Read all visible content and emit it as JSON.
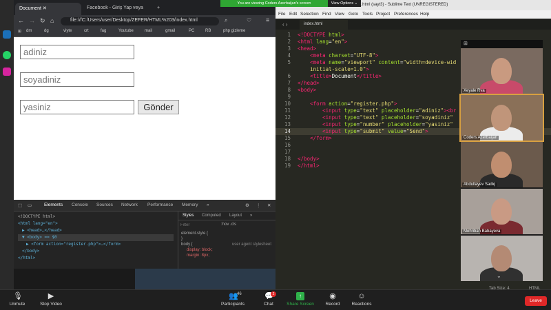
{
  "share_banner": "You are viewing Coders Azerbaijan's screen",
  "view_options": "View Options ⌄",
  "browser": {
    "tabs": [
      {
        "label": "Document"
      },
      {
        "label": "Facebook - Giriş Yap veya"
      }
    ],
    "url": "file:///C:/Users/user/Desktop/ZEFER/HTML%203/index.html",
    "bookmarks": [
      "dm",
      "dg",
      "viyte",
      "crt",
      "fag",
      "Youtube",
      "mail",
      "gmail",
      "PC",
      "RB",
      "php gizleme"
    ],
    "form": {
      "first_placeholder": "adiniz",
      "last_placeholder": "soyadiniz",
      "age_placeholder": "yasiniz",
      "submit_label": "Gönder"
    }
  },
  "devtools": {
    "tabs": [
      "Elements",
      "Console",
      "Sources",
      "Network",
      "Performance",
      "Memory",
      "»"
    ],
    "dom_lines": [
      "<!DOCTYPE html>",
      "<html lang=\"en\">",
      "▶ <head>…</head>",
      "▼ <body> == $0",
      "▶ <form action=\"register.php\">…</form>",
      "</body>",
      "</html>"
    ],
    "style_tabs": [
      "Styles",
      "Computed",
      "Layout",
      "»"
    ],
    "filter_placeholder": "Filter",
    "filter_tools": ":hov .cls",
    "style_lines": [
      "element.style {",
      "}",
      "body {",
      "user agent stylesheet",
      "display: block;",
      "margin: 8px;"
    ]
  },
  "sublime": {
    "title": "C:\\Users\\user\\Desktop\\ZEFER\\HTML 3\\index.html (sayt3) - Sublime Text (UNREGISTERED)",
    "menu": [
      "File",
      "Edit",
      "Selection",
      "Find",
      "View",
      "Goto",
      "Tools",
      "Project",
      "Preferences",
      "Help"
    ],
    "file_tab": "index.html",
    "line_numbers": [
      "1",
      "2",
      "3",
      "4",
      "5",
      "6",
      "7",
      "8",
      "9",
      "10",
      "11",
      "12",
      "13",
      "14",
      "15",
      "16",
      "17",
      "18",
      "19"
    ],
    "status_right": [
      "Tab Size: 4",
      "HTML"
    ]
  },
  "participants": [
    "Xeyale Rva",
    "Coders Azerbaijan",
    "Abdullayev Sadiq",
    "Mehriban Babayeva",
    ""
  ],
  "zoom": {
    "buttons": [
      {
        "label": "Unmute"
      },
      {
        "label": "Stop Video"
      },
      {
        "label": "Participants",
        "count": "46"
      },
      {
        "label": "Chat",
        "count": "2"
      },
      {
        "label": "Share Screen"
      },
      {
        "label": "Record"
      },
      {
        "label": "Reactions"
      }
    ],
    "leave": "Leave"
  },
  "colors": {
    "accent_green": "#2fa633",
    "leave_red": "#e02828",
    "editor_bg": "#272822"
  }
}
